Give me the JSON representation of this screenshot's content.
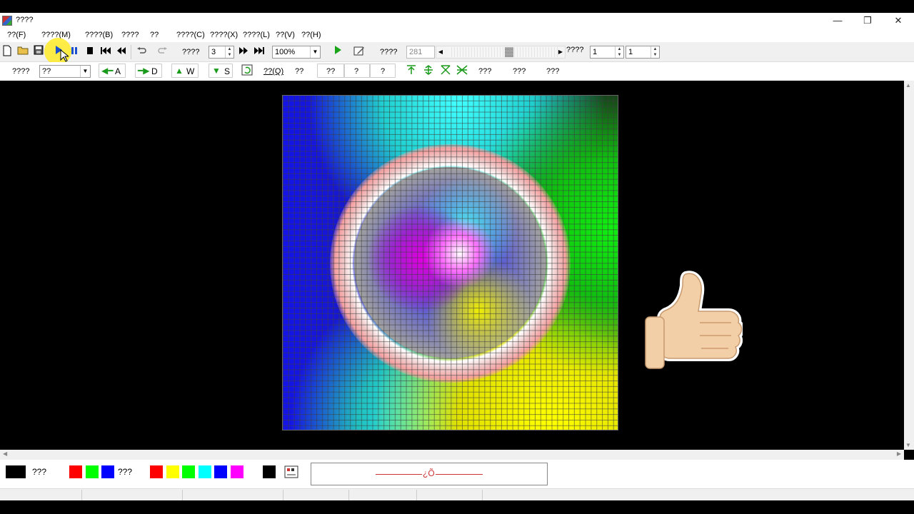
{
  "window": {
    "title": "????",
    "minimize": "—",
    "restore": "❐",
    "close": "✕"
  },
  "menu": [
    {
      "label": "??(F)"
    },
    {
      "label": "????(M)"
    },
    {
      "label": "????(B)"
    },
    {
      "label": "????"
    },
    {
      "label": "??"
    },
    {
      "label": "????(C)"
    },
    {
      "label": "????(X)"
    },
    {
      "label": "????(L)"
    },
    {
      "label": "??(V)"
    },
    {
      "label": "??(H)"
    }
  ],
  "toolbar1": {
    "label1": "????",
    "step_value": "3",
    "zoom_value": "100%",
    "label2": "????",
    "frame_value": "281",
    "label3": "????",
    "spin2_value": "1",
    "spin3_value": "1"
  },
  "toolbar2": {
    "label1": "????",
    "combo_value": "??",
    "btn_a": "A",
    "btn_d": "D",
    "btn_w": "W",
    "btn_s": "S",
    "btn_q": "??(Q)",
    "btn_q2": "??",
    "btn_b1": "??",
    "btn_b2": "?",
    "btn_b3": "?",
    "btn_c1": "???",
    "btn_c2": "???",
    "btn_c3": "???"
  },
  "palette": {
    "label1": "???",
    "label2": "???",
    "colors1": [
      "#000000"
    ],
    "colors2": [
      "#ff0000",
      "#00ff00",
      "#0000ff"
    ],
    "colors3": [
      "#ff0000",
      "#ffff00",
      "#00ff00",
      "#00ffff",
      "#0000ff",
      "#ff00ff",
      "#ffffff",
      "#000000"
    ],
    "preview_text": "¿Õ"
  },
  "icons": {
    "thumbs_up": "thumbs-up-icon"
  }
}
